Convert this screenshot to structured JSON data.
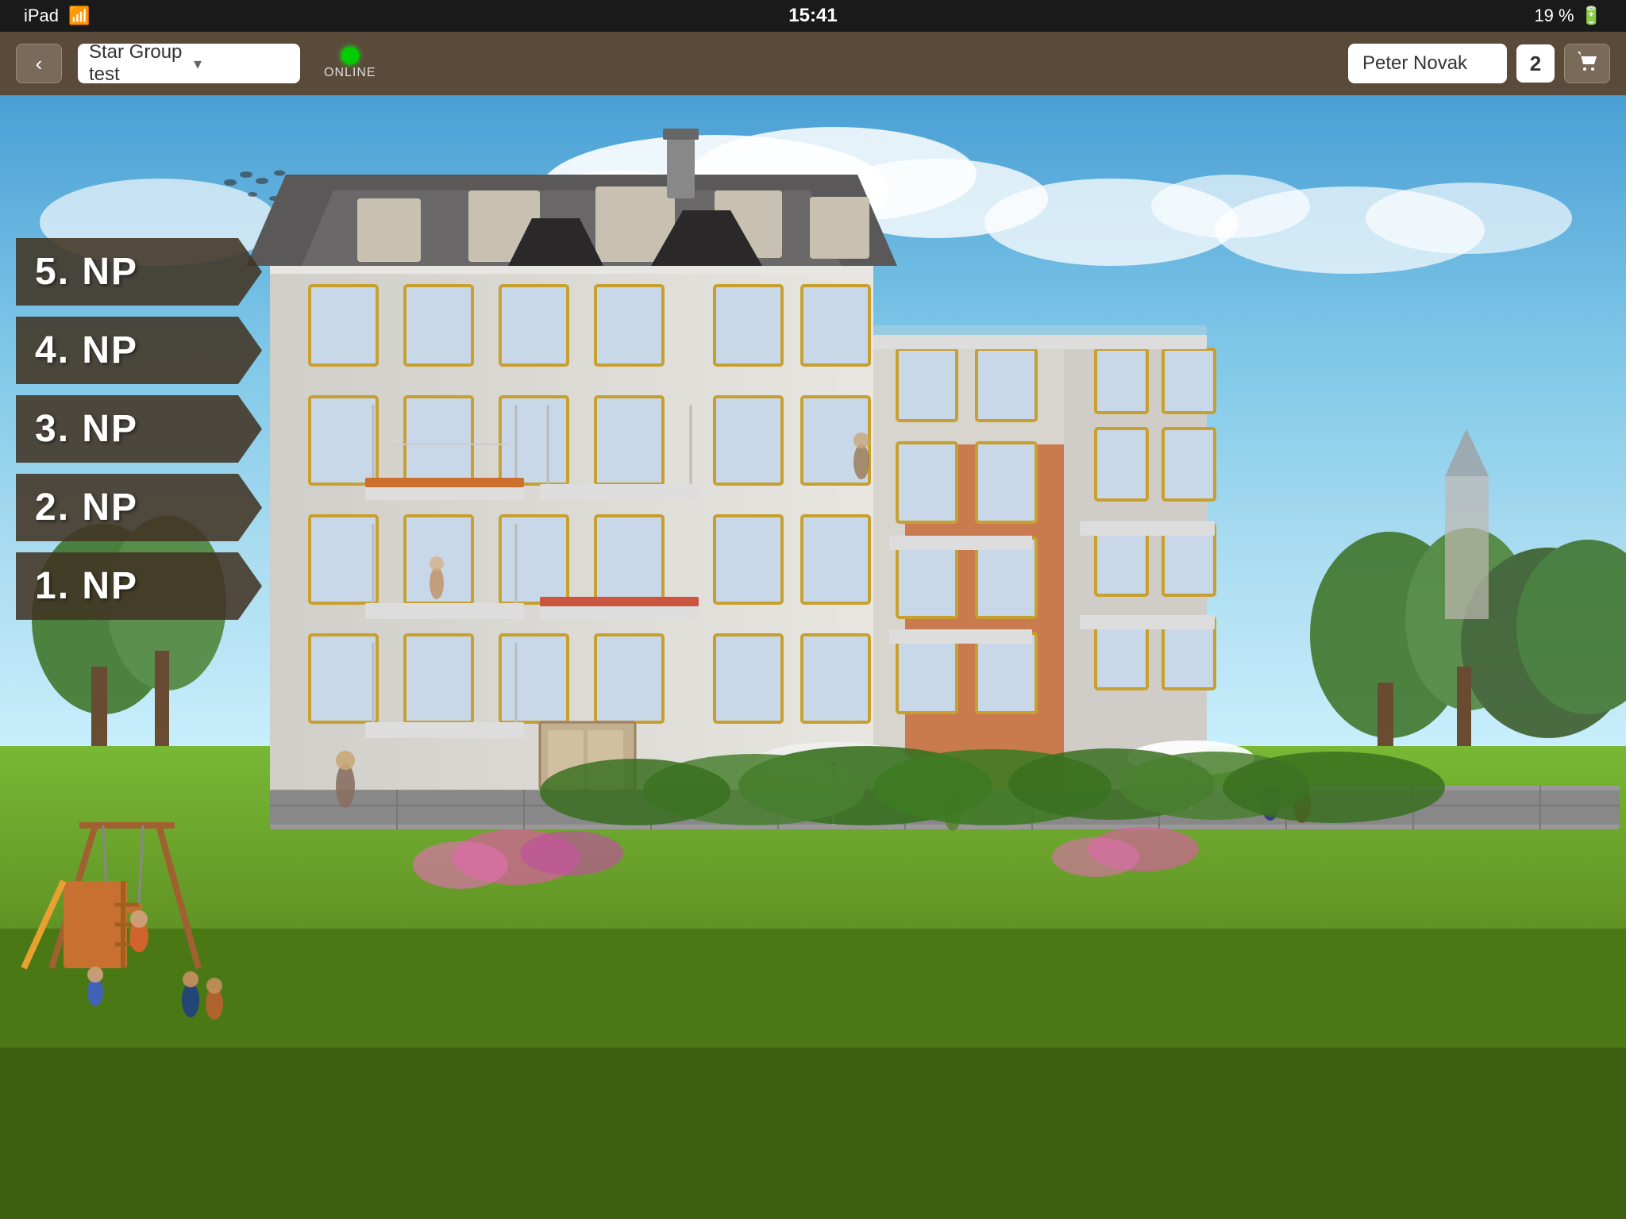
{
  "status_bar": {
    "device": "iPad",
    "wifi_label": "iPad",
    "time": "15:41",
    "battery": "19 %"
  },
  "nav_bar": {
    "back_label": "‹",
    "project_name": "Star Group test",
    "dropdown_arrow": "▾",
    "online_label": "ONLINE",
    "user_name": "Peter  Novak",
    "badge_count": "2",
    "cart_icon": "🛒"
  },
  "floors": [
    {
      "id": "floor-5",
      "label": "5. NP"
    },
    {
      "id": "floor-4",
      "label": "4. NP"
    },
    {
      "id": "floor-3",
      "label": "3. NP"
    },
    {
      "id": "floor-2",
      "label": "2. NP"
    },
    {
      "id": "floor-1",
      "label": "1. NP"
    }
  ],
  "colors": {
    "nav_bg": "#5a4a3a",
    "floor_btn_bg": "rgba(70,55,40,0.85)",
    "online_green": "#00cc00",
    "accent": "#c8860a"
  }
}
